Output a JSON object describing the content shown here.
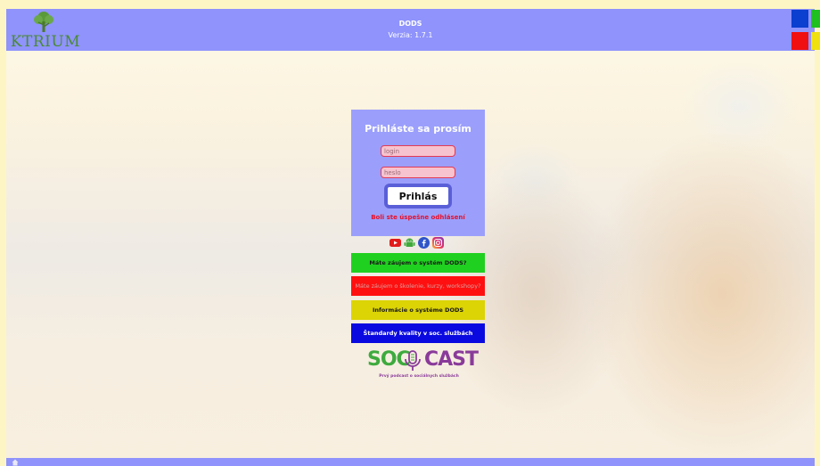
{
  "header": {
    "logo_text": "KTRIUM",
    "app_title": "DODS",
    "version": "Verzia: 1.7.1"
  },
  "login": {
    "heading": "Prihláste sa prosím",
    "username_placeholder": "login",
    "password_placeholder": "heslo",
    "submit_label": "Prihlás",
    "status_message": "Boli ste úspešne odhlásení"
  },
  "social": {
    "icons": [
      "youtube-icon",
      "android-icon",
      "facebook-icon",
      "instagram-icon"
    ]
  },
  "menu": {
    "items": [
      {
        "label": "Máte záujem o systém DODS?",
        "color": "#20d020"
      },
      {
        "label": "Máte záujem o školenie, kurzy, workshopy?",
        "color": "#ff1010"
      },
      {
        "label": "Informácie o systéme DODS",
        "color": "#dcd405"
      },
      {
        "label": "Štandardy kvality v soc. službách",
        "color": "#0a0ae0"
      }
    ]
  },
  "soccast": {
    "soc": "SOC",
    "cast": "CAST",
    "tagline": "Prvý podcast o sociálnych službách"
  },
  "colors": {
    "header": "#8f93fb",
    "panel": "#9b9ffb",
    "error": "#e8102a"
  }
}
